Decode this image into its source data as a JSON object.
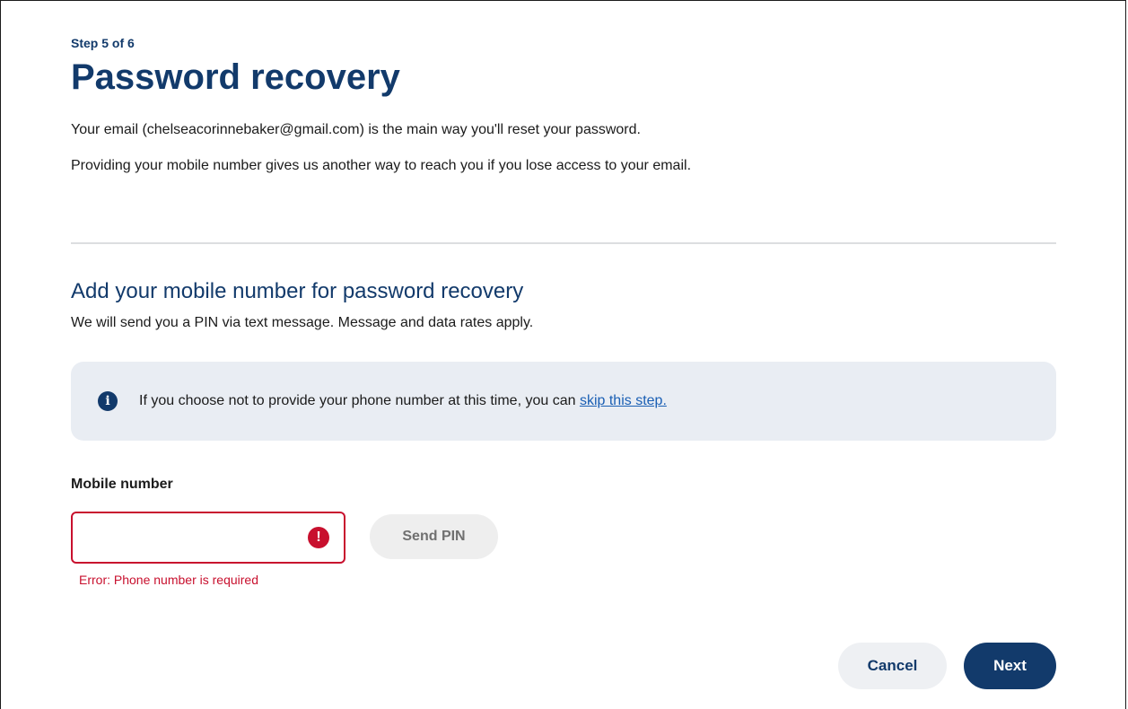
{
  "header": {
    "step": "Step 5 of 6",
    "title": "Password recovery"
  },
  "intro": {
    "email_text": "Your email (chelseacorinnebaker@gmail.com) is the main way you'll reset your password.",
    "mobile_text": "Providing your mobile number gives us another way to reach you if you lose access to your email."
  },
  "mobile_section": {
    "heading": "Add your mobile number for password recovery",
    "subtext": "We will send you a PIN via text message. Message and data rates apply."
  },
  "alert": {
    "icon": "info-icon",
    "text": "If you choose not to provide your phone number at this time, you can ",
    "link": "skip this step."
  },
  "form": {
    "label": "Mobile number",
    "value": "",
    "error_icon": "exclamation-icon",
    "error_message": "Error:  Phone number is required",
    "send_pin": "Send PIN"
  },
  "actions": {
    "cancel": "Cancel",
    "next": "Next"
  },
  "colors": {
    "brand": "#123a6b",
    "error": "#c8102e",
    "link": "#1a5fb4",
    "alert_bg": "#e9edf3"
  }
}
